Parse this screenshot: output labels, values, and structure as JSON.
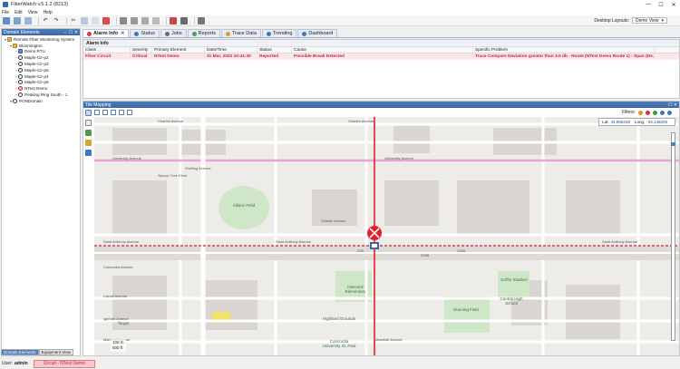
{
  "window": {
    "title": "FiberWatch v.5.1.2 (8213)"
  },
  "menu": [
    "File",
    "Edit",
    "View",
    "Help"
  ],
  "toolbar": {
    "desktop_layouts_label": "Desktop Layouts:",
    "desktop_layout_value": "Demo View"
  },
  "domain_panel": {
    "title": "Domain Elements",
    "tree": [
      {
        "label": "Remote Fiber Monitoring System",
        "level": 0,
        "icon": "folder"
      },
      {
        "label": "Bloomington",
        "level": 1,
        "icon": "folder"
      },
      {
        "label": "Demo RTU",
        "level": 2,
        "icon": "rtu"
      },
      {
        "label": "Maple-Cir-p2",
        "level": 2,
        "icon": "route"
      },
      {
        "label": "Maple-Cir-p3",
        "level": 2,
        "icon": "route"
      },
      {
        "label": "Maple-Cir-p5",
        "level": 2,
        "icon": "route"
      },
      {
        "label": "Maple-Cir-p4",
        "level": 2,
        "icon": "route"
      },
      {
        "label": "Maple-Cir-p6",
        "level": 2,
        "icon": "route"
      },
      {
        "label": "NTest Demo",
        "level": 2,
        "icon": "alarm"
      },
      {
        "label": "Petaling Ring South - 1",
        "level": 2,
        "icon": "route"
      },
      {
        "label": "PONDomain",
        "level": 1,
        "icon": "route"
      }
    ],
    "bottom_tabs": [
      "Domain Elements",
      "Equipment View"
    ]
  },
  "tabs": [
    {
      "label": "Alarm Info",
      "icon_color": "#d23a3a",
      "active": true
    },
    {
      "label": "Status",
      "icon_color": "#3b78c4",
      "active": false
    },
    {
      "label": "Jobs",
      "icon_color": "#6b6b6b",
      "active": false
    },
    {
      "label": "Reports",
      "icon_color": "#4f9a4f",
      "active": false
    },
    {
      "label": "Trace Data",
      "icon_color": "#e09b2d",
      "active": false
    },
    {
      "label": "Trending",
      "icon_color": "#3b78c4",
      "active": false
    },
    {
      "label": "Dashboard",
      "icon_color": "#3b78c4",
      "active": false
    }
  ],
  "alarm_info": {
    "title": "Alarm Info",
    "columns": [
      "Class",
      "Severity",
      "Primary Element",
      "Date/Time",
      "Status",
      "Cause",
      "Specific Problem"
    ],
    "rows": [
      [
        "Fiber Circuit",
        "Critical",
        "NTest Demo",
        "31 Mar, 2022 10:41:30",
        "Reported",
        "Possible Break Detected",
        "Trace Compare Deviation greater than 3.0 db - Route (NTest Demo Route 1) - Span (De..."
      ]
    ]
  },
  "map": {
    "title": "Tile Mapping",
    "filters_label": "Filters:",
    "lat_label": "Lat:",
    "lat_value": "44.955436",
    "long_label": "Long:",
    "long_value": "-93.148205",
    "scale_m": "100 m",
    "scale_ft": "500 ft",
    "streets": {
      "charles": "Charles Avenue",
      "university": "University Avenue",
      "snelling": "Snelling Avenue",
      "spruce": "Spruce Tree Drive",
      "shields": "Shields Avenue",
      "st_anthony": "Saint Anthony Avenue",
      "concordia": "Concordia Avenue",
      "carroll": "Carroll Avenue",
      "iglehart": "Iglehart Avenue",
      "marshall": "Marshall Avenue",
      "i94_a": "238",
      "i94_b": "239A",
      "i94_c": "239B"
    },
    "pois": {
      "allianz": "Allianz Field",
      "griffin": "Griffin Stadium",
      "dunning": "Dunning Field",
      "central": "Central High School",
      "highland": "Highland Grounds",
      "concordia_u": "Concordia University St. Paul",
      "hancock": "Hancock Elementary",
      "target": "Target"
    }
  },
  "status": {
    "user_label": "User:",
    "user_value": "admin",
    "alarm_text": "Circuit - NTest Demo"
  },
  "colors": {
    "accent": "#3b68a2",
    "critical": "#c0243a",
    "route": "#e31f2a"
  }
}
